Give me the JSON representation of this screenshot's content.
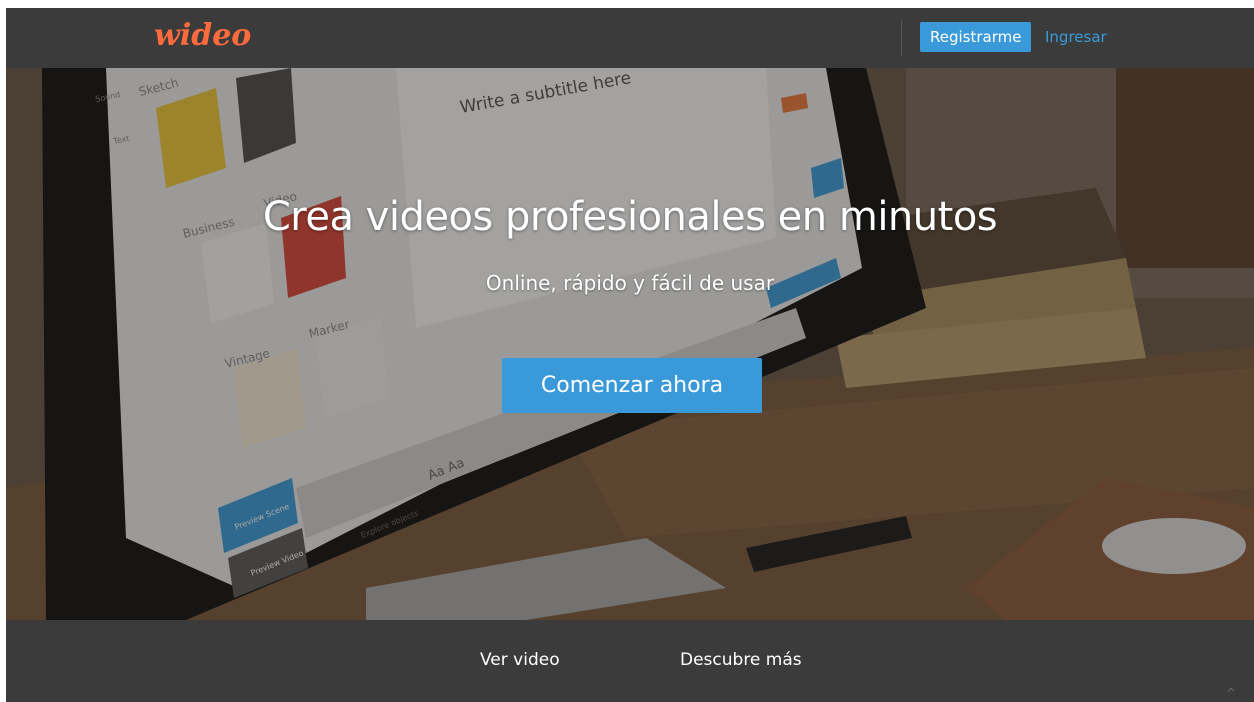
{
  "header": {
    "logo": "wideo",
    "register_label": "Registrarme",
    "login_label": "Ingresar"
  },
  "hero": {
    "title": "Crea videos profesionales en minutos",
    "subtitle": "Online, rápido y fácil de usar",
    "cta_label": "Comenzar ahora",
    "screen": {
      "subtitle_text": "Write a subtitle here",
      "categories": [
        "Sketch",
        "Video",
        "Business",
        "Marker",
        "Vintage"
      ],
      "tools": [
        "Sound",
        "Text"
      ],
      "preview_scene": "Preview Scene",
      "preview_video": "Preview Video",
      "explore_objects": "Explore objects",
      "font_sample": "Aa Aa"
    }
  },
  "footer": {
    "video_link": "Ver video",
    "discover_link": "Descubre más",
    "scroll_glyph": "^"
  },
  "colors": {
    "nav_bg": "#3b3b3b",
    "brand": "#ff6b3d",
    "accent": "#3a9ad9",
    "text_light": "#ffffff"
  }
}
